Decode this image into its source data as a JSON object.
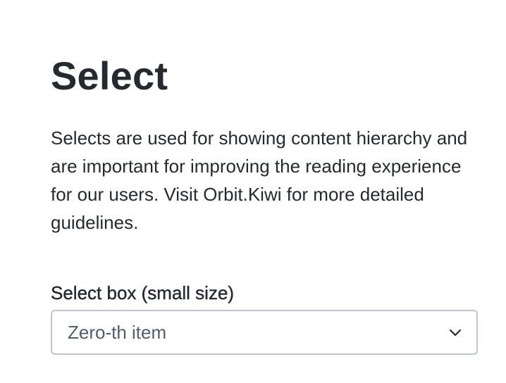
{
  "page": {
    "title": "Select",
    "description": "Selects are used for showing content hierarchy and are important for improving the reading experience for our users. Visit Orbit.Kiwi for more detailed guidelines."
  },
  "select_small": {
    "label": "Select box (small size)",
    "selected_value": "Zero-th item",
    "icon": "chevron-down-icon"
  },
  "colors": {
    "text": "#252a31",
    "select_text": "#4f5e71",
    "border": "#bac7d5"
  }
}
